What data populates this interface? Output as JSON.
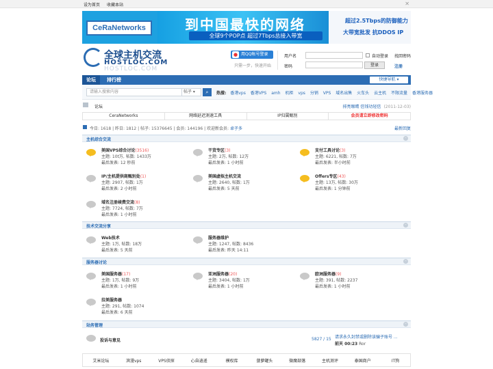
{
  "topbar": {
    "set_home": "设为首页",
    "bookmark": "收藏本站",
    "close": "✕"
  },
  "banner": {
    "brand": "CeRaNetworks",
    "headline": "到中国最快的网络",
    "subline": "全球9个POP点  超过7Tbps总接入带宽",
    "right_top": "超过2.5Tbps的防御能力",
    "right_bottom": "大带宽批发  抗DDOS IP"
  },
  "site_logo": {
    "cn": "全球主机交流",
    "en": "HOSTLOC.COM",
    "mirror": "HOSTLOC.COM"
  },
  "qq_login": {
    "label": "用QQ帐号登录",
    "hint": "只需一步，快速开始"
  },
  "login": {
    "username_label": "用户名",
    "password_label": "密码",
    "auto_login": "自动登录",
    "find_password": "找回密码",
    "submit": "登录",
    "register": "注册"
  },
  "nav": {
    "tabs": [
      "论坛",
      "排行榜"
    ],
    "quick": "快捷导航 ▾"
  },
  "search": {
    "placeholder": "请输入搜索内容",
    "scope": "帖子 ▾",
    "hot_label": "热搜:",
    "hot": [
      "香港vps",
      "香港VPS",
      "amh",
      "机柜",
      "vps",
      "分销",
      "VPS",
      "域名出售",
      "火车头",
      "云主机",
      "不限流量",
      "香港服务器"
    ]
  },
  "crumb": {
    "current": "论坛",
    "right_link": "排亮眼睛 信钱功轻信",
    "right_date": "(2011-12-03)"
  },
  "shortcuts": [
    "CeraNetworks",
    "网络延迟测速工具",
    "IP归属甄别",
    "会员请立即修改密码"
  ],
  "stats": {
    "text": "今日: 1618  |  昨日: 1812  |  帖子: 15376645  |  会员: 144196  |  欢迎新会员: ",
    "new_member": "卓子多",
    "latest": "最新回复"
  },
  "sections": [
    {
      "title": "主机综合交流",
      "forums": [
        {
          "name": "美国VPS综合讨论",
          "today": "(3516)",
          "line2": "主题: 10t万, 帖数: 1433万",
          "line3": "最后发表: 12 秒前",
          "new": true
        },
        {
          "name": "干货专区",
          "today": "(3)",
          "line2": "主题: 2万, 帖数: 12万",
          "line3": "最后发表: 1 小时前",
          "new": false
        },
        {
          "name": "支付工具讨论",
          "today": "(3)",
          "line2": "主题: 6221, 帖数: 7万",
          "line3": "最后发表: 半小时前",
          "new": true
        },
        {
          "name": "IP/主机提供商甄别处",
          "today": "(1)",
          "line2": "主题: 2907, 帖数: 1万",
          "line3": "最后发表: 2 小时前",
          "new": false
        },
        {
          "name": "美国虚拟主机交流",
          "today": "",
          "line2": "主题: 2640, 帖数: 1万",
          "line3": "最后发表: 5 天前",
          "new": false
        },
        {
          "name": "Offers专区",
          "today": "(43)",
          "line2": "主题: 13万, 帖数: 30万",
          "line3": "最后发表: 1 分钟前",
          "new": true
        },
        {
          "name": "域名注册续费交流",
          "today": "(8)",
          "line2": "主题: 7724, 帖数: 7万",
          "line3": "最后发表: 1 小时前",
          "new": false
        }
      ]
    },
    {
      "title": "技术交流分享",
      "forums": [
        {
          "name": "Web技术",
          "today": "",
          "line2": "主题: 1万, 帖数: 18万",
          "line3": "最后发表: 5 天前",
          "new": false
        },
        {
          "name": "服务器维护",
          "today": "",
          "line2": "主题: 1247, 帖数: 8436",
          "line3": "最后发表: 昨天 14:11",
          "new": false
        }
      ]
    },
    {
      "title": "服务器讨论",
      "forums": [
        {
          "name": "美国服务器",
          "today": "(17)",
          "line2": "主题: 1万, 帖数: 9万",
          "line3": "最后发表: 1 小时前",
          "new": false
        },
        {
          "name": "亚洲服务器",
          "today": "(20)",
          "line2": "主题: 3404, 帖数: 1万",
          "line3": "最后发表: 1 小时前",
          "new": false
        },
        {
          "name": "欧洲服务器",
          "today": "(9)",
          "line2": "主题: 391, 帖数: 2237",
          "line3": "最后发表: 1 小时前",
          "new": false
        },
        {
          "name": "拉美服务器",
          "today": "",
          "line2": "主题: 291, 帖数: 1074",
          "line3": "最后发表: 6 天前",
          "new": false
        }
      ]
    },
    {
      "title": "站务管理",
      "forums": []
    }
  ],
  "feedback": {
    "name": "投诉与意见",
    "counts": "5827 / 15",
    "last_title": "请求永久封禁或删除该骗子账号 ...",
    "last_by": "前天 00:23",
    "last_user": "Ror"
  },
  "footer": [
    "艾米论坛",
    "滨漫vps",
    "VPS侦探",
    "心自逍遥",
    "模权库",
    "菠萝罐头",
    "微魔部落",
    "主机测评",
    "泰国商户",
    "IT狗"
  ]
}
